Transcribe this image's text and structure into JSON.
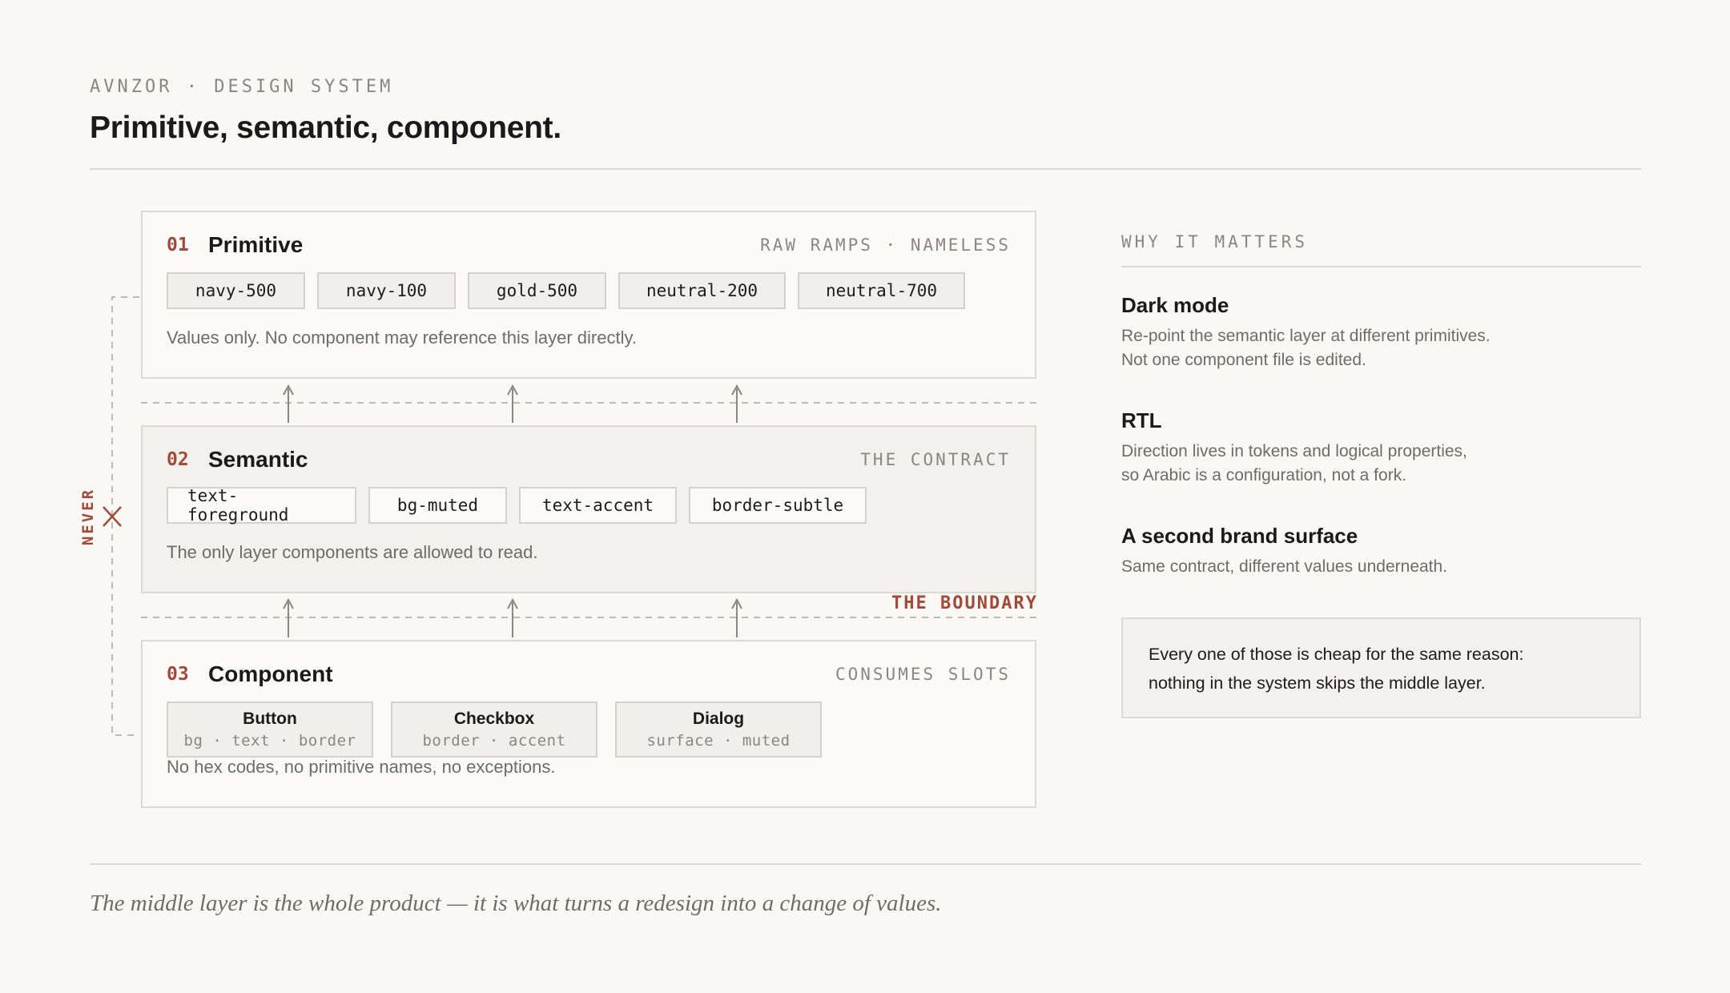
{
  "header": {
    "eyebrow": "AVNZOR · DESIGN SYSTEM",
    "title": "Primitive, semantic, component."
  },
  "layers": [
    {
      "number": "01",
      "name": "Primitive",
      "tag": "RAW RAMPS · NAMELESS",
      "tokens": [
        "navy-500",
        "navy-100",
        "gold-500",
        "neutral-200",
        "neutral-700"
      ],
      "note": "Values only. No component may reference this layer directly."
    },
    {
      "number": "02",
      "name": "Semantic",
      "tag": "THE CONTRACT",
      "tokens": [
        "text-foreground",
        "bg-muted",
        "text-accent",
        "border-subtle"
      ],
      "note": "The only layer components are allowed to read."
    },
    {
      "number": "03",
      "name": "Component",
      "tag": "CONSUMES SLOTS",
      "components": [
        {
          "name": "Button",
          "slots": "bg · text · border"
        },
        {
          "name": "Checkbox",
          "slots": "border · accent"
        },
        {
          "name": "Dialog",
          "slots": "surface · muted"
        }
      ],
      "note": "No hex codes, no primitive names, no exceptions."
    }
  ],
  "diagram": {
    "never_label": "NEVER",
    "boundary_label": "THE BOUNDARY"
  },
  "sidebar": {
    "eyebrow": "WHY IT MATTERS",
    "reasons": [
      {
        "title": "Dark mode",
        "body": "Re-point the semantic layer at different primitives.\nNot one component file is edited."
      },
      {
        "title": "RTL",
        "body": "Direction lives in tokens and logical properties,\nso Arabic is a configuration, not a fork."
      },
      {
        "title": "A second brand surface",
        "body": "Same contract, different values underneath."
      }
    ],
    "callout": "Every one of those is cheap for the same reason:\nnothing in the system skips the middle layer."
  },
  "footer": {
    "quote": "The middle layer is the whole product — it is what turns a redesign into a change of values."
  },
  "colors": {
    "background": "#f9f8f5",
    "accent": "#a24a3a",
    "muted_text": "#6f6c67",
    "border": "#dcdad5",
    "semantic_fill": "#f3f1ed"
  }
}
